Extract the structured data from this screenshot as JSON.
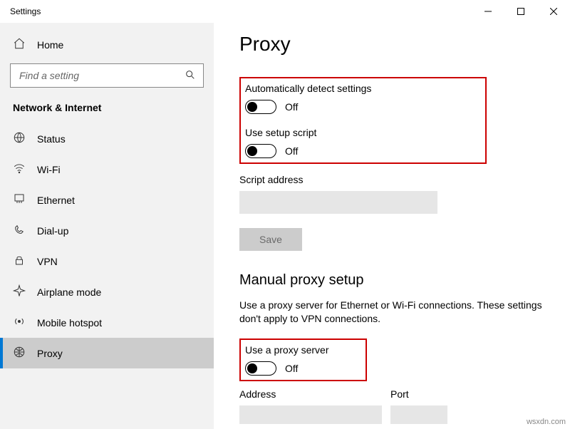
{
  "window": {
    "title": "Settings"
  },
  "sidebar": {
    "home": "Home",
    "search_placeholder": "Find a setting",
    "section": "Network & Internet",
    "items": [
      {
        "icon": "globe",
        "label": "Status"
      },
      {
        "icon": "wifi",
        "label": "Wi-Fi"
      },
      {
        "icon": "ethernet",
        "label": "Ethernet"
      },
      {
        "icon": "dialup",
        "label": "Dial-up"
      },
      {
        "icon": "vpn",
        "label": "VPN"
      },
      {
        "icon": "airplane",
        "label": "Airplane mode"
      },
      {
        "icon": "hotspot",
        "label": "Mobile hotspot"
      },
      {
        "icon": "proxy",
        "label": "Proxy"
      }
    ],
    "active_index": 7
  },
  "page": {
    "title": "Proxy",
    "auto_detect": {
      "label": "Automatically detect settings",
      "state": "Off"
    },
    "use_script": {
      "label": "Use setup script",
      "state": "Off"
    },
    "script_address_label": "Script address",
    "save_label": "Save",
    "manual_title": "Manual proxy setup",
    "manual_desc": "Use a proxy server for Ethernet or Wi-Fi connections. These settings don't apply to VPN connections.",
    "use_proxy": {
      "label": "Use a proxy server",
      "state": "Off"
    },
    "address_label": "Address",
    "port_label": "Port"
  },
  "watermark": "wsxdn.com"
}
